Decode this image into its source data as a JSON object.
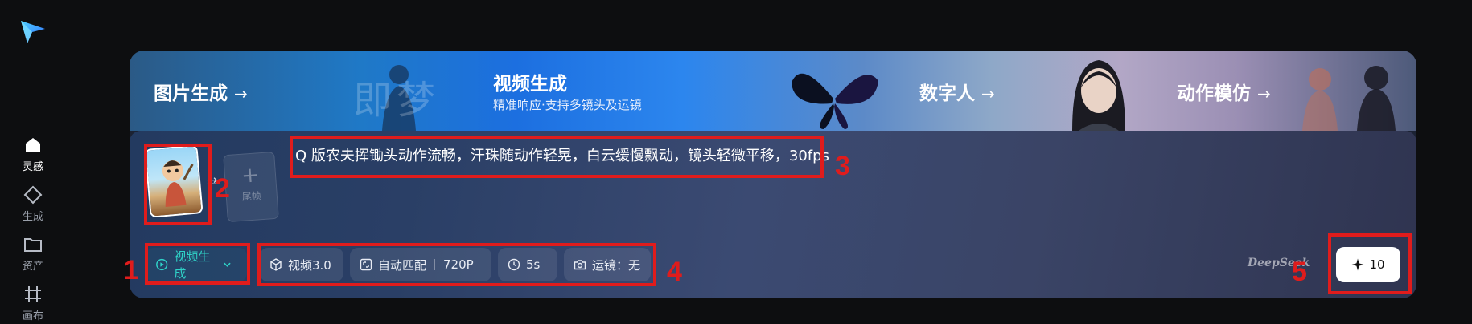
{
  "rail": {
    "items": [
      {
        "label": "灵感",
        "icon": "home-icon",
        "active": true
      },
      {
        "label": "生成",
        "icon": "diamond-icon"
      },
      {
        "label": "资产",
        "icon": "folder-icon"
      },
      {
        "label": "画布",
        "icon": "canvas-grid-icon"
      }
    ]
  },
  "banner": {
    "image_gen": "图片生成",
    "video_title": "视频生成",
    "video_sub": "精准响应·支持多镜头及运镜",
    "watermark": "即梦",
    "digital_human": "数字人",
    "motion_mimic": "动作模仿",
    "arrow": "→"
  },
  "frames": {
    "tail_label": "尾帧",
    "plus": "+",
    "swap": "⇄"
  },
  "prompt": {
    "text": "Q 版农夫挥锄头动作流畅，汗珠随动作轻晃，白云缓慢飘动，镜头轻微平移，30fps"
  },
  "toolbar": {
    "mode": "视频生成",
    "model": "视频3.0",
    "ratio": "自动匹配",
    "resolution": "720P",
    "duration": "5s",
    "camera": "运镜：无",
    "watermark_brand": "DeepSeek",
    "generate_cost": "10"
  },
  "annotations": [
    "1",
    "2",
    "3",
    "4",
    "5"
  ],
  "colors": {
    "accent_teal": "#2fd3c8",
    "annotation_red": "#e01c1c"
  }
}
